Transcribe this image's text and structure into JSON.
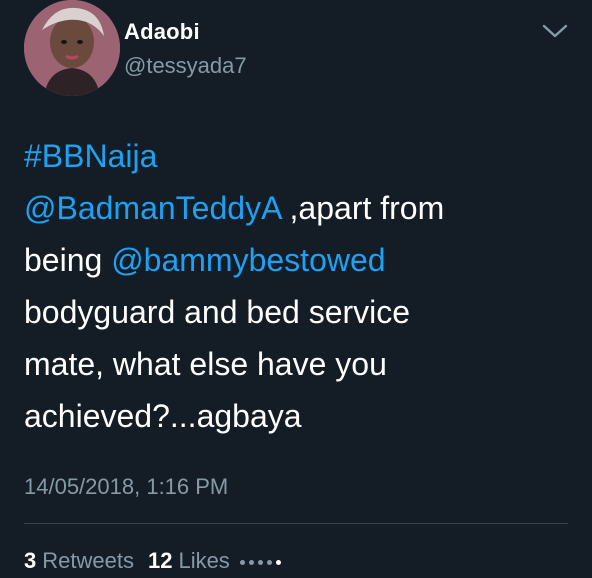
{
  "author": {
    "name": "Adaobi",
    "handle": "@tessyada7"
  },
  "tweet": {
    "lines": [
      [
        {
          "text": "#BBNaija",
          "link": true
        }
      ],
      [
        {
          "text": "@BadmanTeddyA",
          "link": true
        },
        {
          "text": " ,apart from",
          "link": false
        }
      ],
      [
        {
          "text": "being ",
          "link": false
        },
        {
          "text": "@bammybestowed",
          "link": true
        }
      ],
      [
        {
          "text": "bodyguard and bed service",
          "link": false
        }
      ],
      [
        {
          "text": "mate, what else have you",
          "link": false
        }
      ],
      [
        {
          "text": "achieved?...agbaya",
          "link": false
        }
      ]
    ],
    "timestamp": "14/05/2018, 1:16 PM"
  },
  "stats": {
    "retweets_count": "3",
    "retweets_label": "Retweets",
    "likes_count": "12",
    "likes_label": "Likes"
  },
  "icons": {
    "caret": "chevron-down-icon",
    "avatar": "profile-photo"
  },
  "colors": {
    "background": "#141d26",
    "text": "#ffffff",
    "muted": "#8899a6",
    "link": "#1da1f2",
    "divider": "#38444d"
  }
}
